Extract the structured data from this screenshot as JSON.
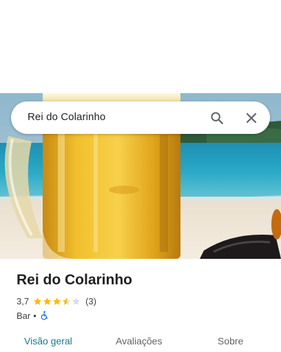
{
  "search": {
    "query": "Rei do Colarinho"
  },
  "place": {
    "name": "Rei do Colarinho",
    "rating": "3,7",
    "stars": 3.7,
    "review_count": "(3)",
    "category": "Bar",
    "separator": "•"
  },
  "tabs": [
    {
      "label": "Visão geral",
      "active": true
    },
    {
      "label": "Avaliações",
      "active": false
    },
    {
      "label": "Sobre",
      "active": false
    }
  ],
  "colors": {
    "accent": "#137a8b",
    "star": "#fbbc04",
    "star_empty": "#dadce0",
    "accessibility_icon": "#1a73e8"
  }
}
